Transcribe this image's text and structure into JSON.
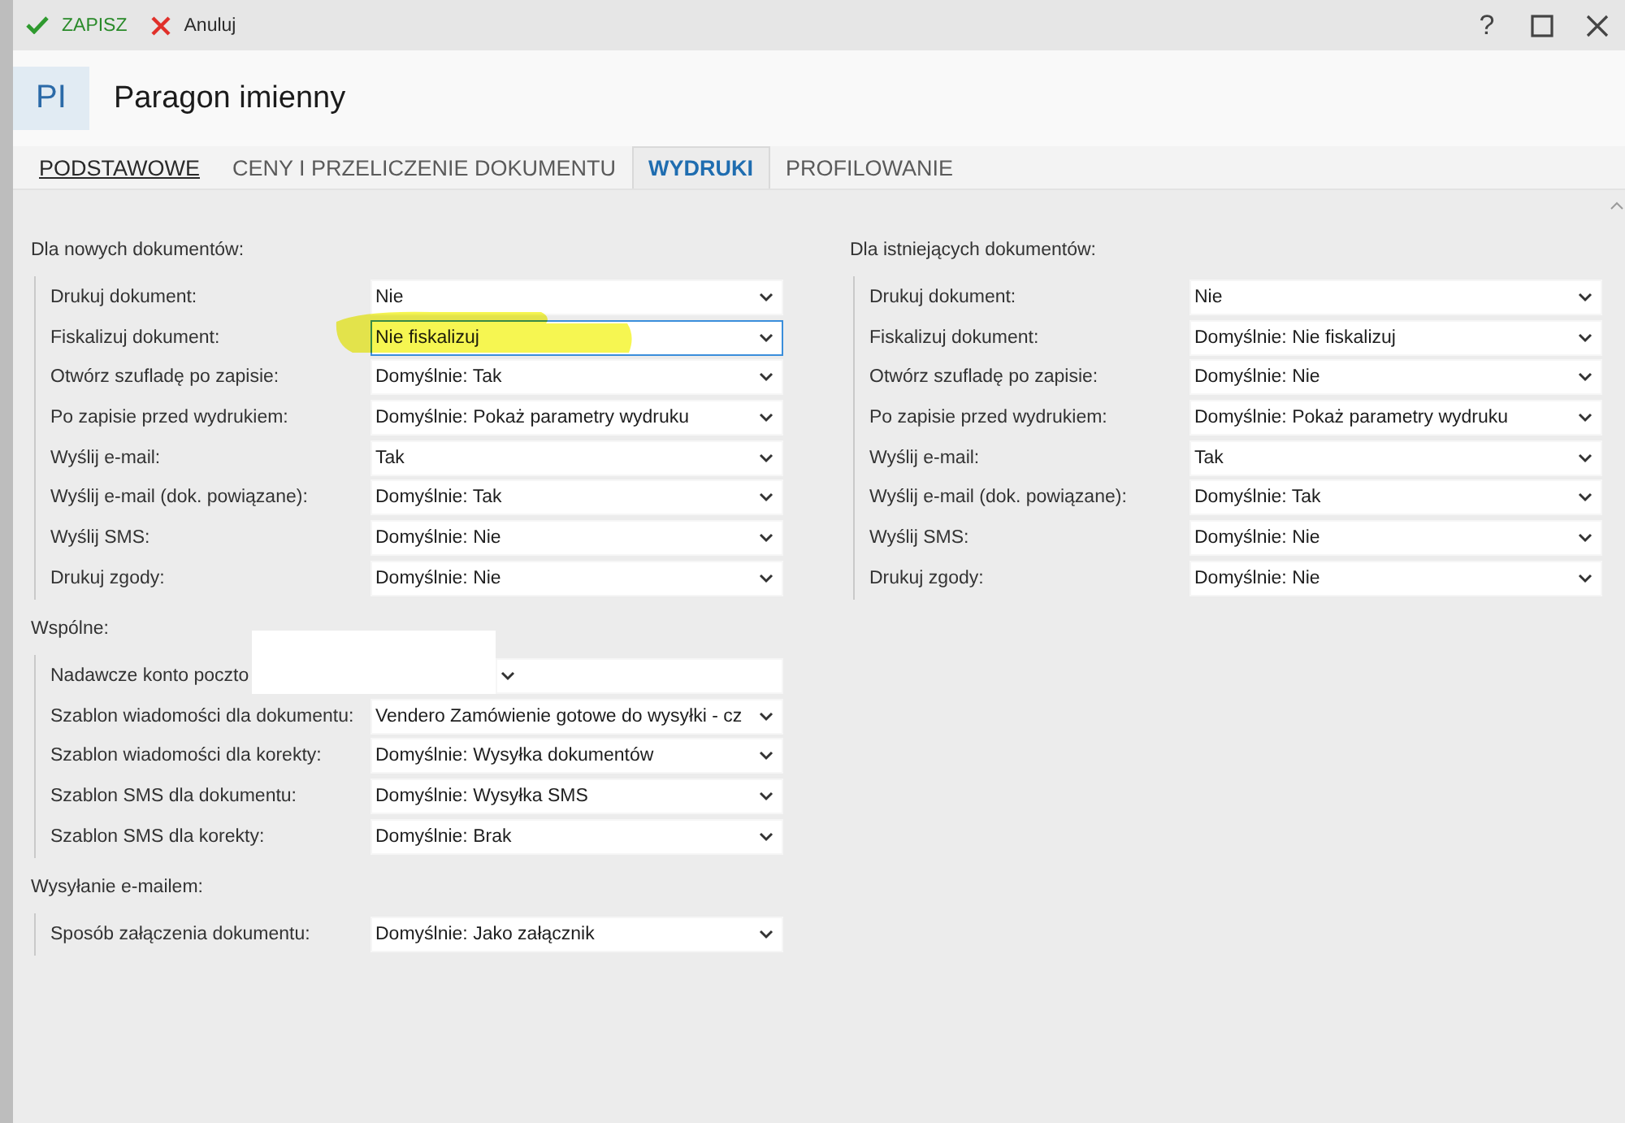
{
  "toolbar": {
    "save_button": "ZAPISZ",
    "cancel_button": "Anuluj",
    "help_button": "?"
  },
  "header": {
    "badge": "PI",
    "title": "Paragon imienny"
  },
  "tabs": [
    {
      "label": "PODSTAWOWE",
      "selected": false,
      "focused": true
    },
    {
      "label": "CENY I PRZELICZENIE DOKUMENTU",
      "selected": false,
      "focused": false
    },
    {
      "label": "WYDRUKI",
      "selected": true,
      "focused": false
    },
    {
      "label": "PROFILOWANIE",
      "selected": false,
      "focused": false
    }
  ],
  "columns": [
    {
      "groups": [
        {
          "title": "Dla nowych dokumentów:",
          "rows": [
            {
              "label": "Drukuj dokument:",
              "value": "Nie",
              "focused": false,
              "highlighted": false,
              "redacted": false
            },
            {
              "label": "Fiskalizuj dokument:",
              "value": "Nie fiskalizuj",
              "focused": true,
              "highlighted": true,
              "redacted": false
            },
            {
              "label": "Otwórz szufladę po zapisie:",
              "value": "Domyślnie: Tak",
              "focused": false,
              "highlighted": false,
              "redacted": false
            },
            {
              "label": "Po zapisie przed wydrukiem:",
              "value": "Domyślnie: Pokaż parametry wydruku",
              "focused": false,
              "highlighted": false,
              "redacted": false
            },
            {
              "label": "Wyślij e-mail:",
              "value": "Tak",
              "focused": false,
              "highlighted": false,
              "redacted": false
            },
            {
              "label": "Wyślij e-mail (dok. powiązane):",
              "value": "Domyślnie: Tak",
              "focused": false,
              "highlighted": false,
              "redacted": false
            },
            {
              "label": "Wyślij SMS:",
              "value": "Domyślnie: Nie",
              "focused": false,
              "highlighted": false,
              "redacted": false
            },
            {
              "label": "Drukuj zgody:",
              "value": "Domyślnie: Nie",
              "focused": false,
              "highlighted": false,
              "redacted": false
            }
          ]
        },
        {
          "title": "Wspólne:",
          "rows": [
            {
              "label": "Nadawcze konto poczto",
              "focused": false,
              "highlighted": false,
              "redacted": true
            },
            {
              "label": "Szablon wiadomości dla dokumentu:",
              "value": "Vendero Zamówienie gotowe do wysyłki - cz",
              "focused": false,
              "highlighted": false,
              "redacted": false
            },
            {
              "label": "Szablon wiadomości dla korekty:",
              "value": "Domyślnie: Wysyłka dokumentów",
              "focused": false,
              "highlighted": false,
              "redacted": false
            },
            {
              "label": "Szablon SMS dla dokumentu:",
              "value": "Domyślnie: Wysyłka SMS",
              "focused": false,
              "highlighted": false,
              "redacted": false
            },
            {
              "label": "Szablon SMS dla korekty:",
              "value": "Domyślnie: Brak",
              "focused": false,
              "highlighted": false,
              "redacted": false
            }
          ]
        },
        {
          "title": "Wysyłanie e-mailem:",
          "rows": [
            {
              "label": "Sposób załączenia dokumentu:",
              "value": "Domyślnie: Jako załącznik",
              "focused": false,
              "highlighted": false,
              "redacted": false
            }
          ]
        }
      ]
    },
    {
      "groups": [
        {
          "title": "Dla istniejących dokumentów:",
          "rows": [
            {
              "label": "Drukuj dokument:",
              "value": "Nie",
              "focused": false,
              "highlighted": false,
              "redacted": false
            },
            {
              "label": "Fiskalizuj dokument:",
              "value": "Domyślnie: Nie fiskalizuj",
              "focused": false,
              "highlighted": false,
              "redacted": false
            },
            {
              "label": "Otwórz szufladę po zapisie:",
              "value": "Domyślnie: Nie",
              "focused": false,
              "highlighted": false,
              "redacted": false
            },
            {
              "label": "Po zapisie przed wydrukiem:",
              "value": "Domyślnie: Pokaż parametry wydruku",
              "focused": false,
              "highlighted": false,
              "redacted": false
            },
            {
              "label": "Wyślij e-mail:",
              "value": "Tak",
              "focused": false,
              "highlighted": false,
              "redacted": false
            },
            {
              "label": "Wyślij e-mail (dok. powiązane):",
              "value": "Domyślnie: Tak",
              "focused": false,
              "highlighted": false,
              "redacted": false
            },
            {
              "label": "Wyślij SMS:",
              "value": "Domyślnie: Nie",
              "focused": false,
              "highlighted": false,
              "redacted": false
            },
            {
              "label": "Drukuj zgody:",
              "value": "Domyślnie: Nie",
              "focused": false,
              "highlighted": false,
              "redacted": false
            }
          ]
        }
      ]
    }
  ]
}
